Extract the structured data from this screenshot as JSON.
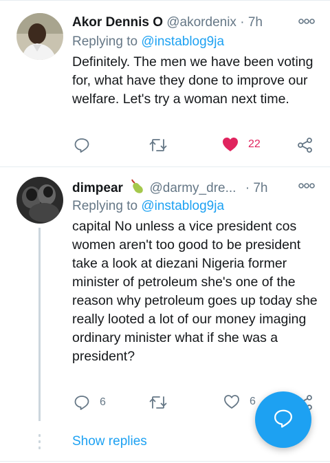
{
  "tweets": [
    {
      "name": "Akor Dennis O",
      "handle": "@akordenix",
      "separator": "·",
      "time": "7h",
      "replying_prefix": "Replying to ",
      "replying_handle": "@instablog9ja",
      "body": "Definitely. The men we have been voting for, what have they done to improve our welfare. Let's try a woman next time.",
      "reply_count": "",
      "retweet_count": "",
      "like_count": "22",
      "liked": true
    },
    {
      "name": "dimpear",
      "handle": "@darmy_dre...",
      "separator": "·",
      "time": "7h",
      "replying_prefix": "Replying to ",
      "replying_handle": "@instablog9ja",
      "body": "capital No unless a vice president cos women aren't too good to be president take a look at diezani Nigeria former minister of petroleum she's one of the reason why petroleum goes up today she really looted a lot of our money imaging ordinary minister what if she was a president?",
      "reply_count": "6",
      "retweet_count": "",
      "like_count": "6",
      "liked": false
    }
  ],
  "show_replies_label": "Show replies",
  "colors": {
    "accent": "#1da1f2",
    "like": "#e0245e",
    "muted": "#657786"
  },
  "icons": [
    "more-icon",
    "reply-icon",
    "retweet-icon",
    "like-icon",
    "share-icon",
    "pear-emoji-icon",
    "compose-reply-icon"
  ]
}
